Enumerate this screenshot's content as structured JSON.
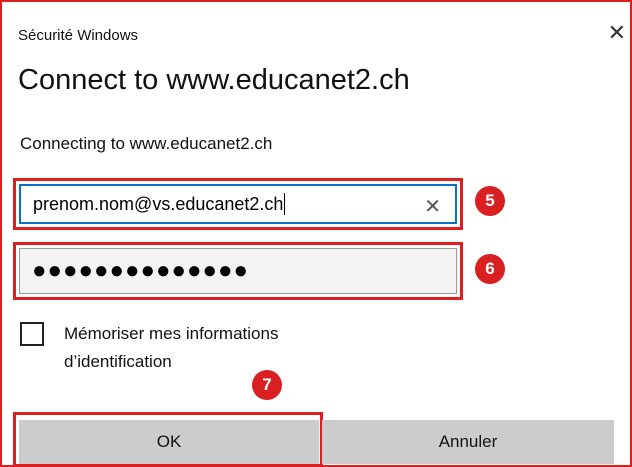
{
  "window": {
    "title": "Sécurité Windows",
    "close_glyph": "✕"
  },
  "dialog": {
    "heading": "Connect to www.educanet2.ch",
    "subtitle": "Connecting to www.educanet2.ch"
  },
  "username": {
    "value": "prenom.nom@vs.educanet2.ch",
    "clear_glyph": "✕"
  },
  "password": {
    "masked_value": "●●●●●●●●●●●●●●"
  },
  "remember": {
    "checked": false,
    "label_line1": "Mémoriser mes informations",
    "label_line2": "d’identification"
  },
  "buttons": {
    "ok": "OK",
    "cancel": "Annuler"
  },
  "annotations": {
    "step5": "5",
    "step6": "6",
    "step7": "7"
  },
  "colors": {
    "highlight": "#e01e1e",
    "badge": "#d91f1f",
    "focus_border": "#0a6fc7",
    "button_bg": "#cccccc"
  }
}
